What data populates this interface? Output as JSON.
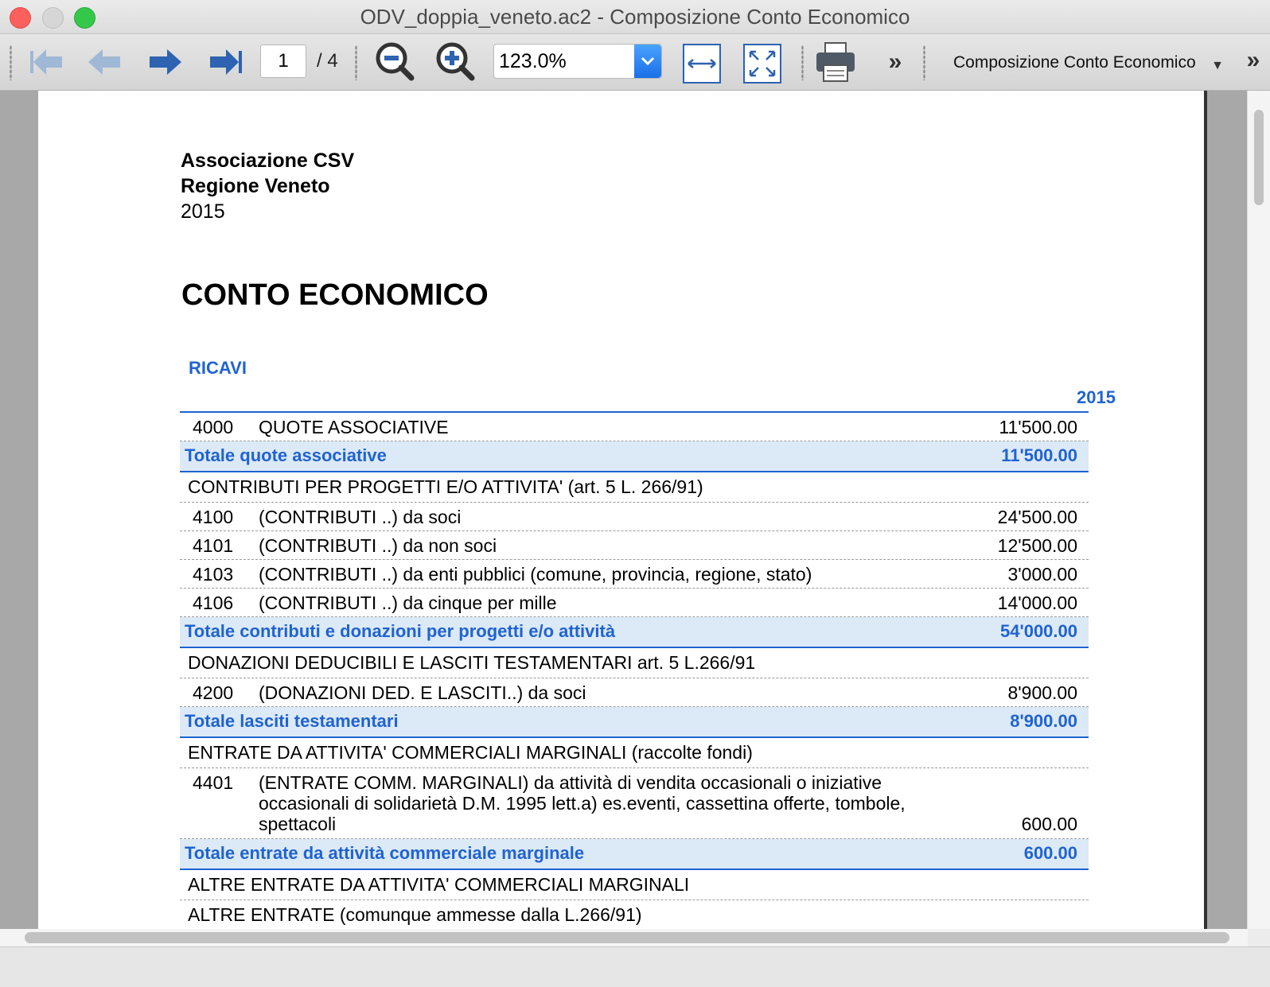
{
  "window": {
    "title": "ODV_doppia_veneto.ac2 - Composizione Conto Economico"
  },
  "toolbar": {
    "page_current": "1",
    "page_total": "/ 4",
    "zoom": "123.0%",
    "sheet_title": "Composizione Conto Economico",
    "icons": [
      "first-page-icon",
      "previous-page-icon",
      "next-page-icon",
      "last-page-icon",
      "zoom-out-icon",
      "zoom-in-icon",
      "fit-width-icon",
      "fit-page-icon",
      "print-icon",
      "more-icon"
    ]
  },
  "document": {
    "org_name": "Associazione CSV",
    "region": "Regione Veneto",
    "year": "2015",
    "heading": "CONTO ECONOMICO",
    "section": "RICAVI",
    "column_year": "2015",
    "rows": [
      {
        "type": "item",
        "code": "4000",
        "desc": "QUOTE ASSOCIATIVE",
        "amount": "11'500.00"
      },
      {
        "type": "total",
        "desc": "Totale quote associative",
        "amount": "11'500.00"
      },
      {
        "type": "group",
        "desc": "CONTRIBUTI PER PROGETTI E/O ATTIVITA'  (art. 5 L. 266/91)"
      },
      {
        "type": "item",
        "code": "4100",
        "desc": "(CONTRIBUTI ..) da soci",
        "amount": "24'500.00"
      },
      {
        "type": "item",
        "code": "4101",
        "desc": "(CONTRIBUTI ..) da non soci",
        "amount": "12'500.00"
      },
      {
        "type": "item",
        "code": "4103",
        "desc": "(CONTRIBUTI ..)  da enti pubblici (comune, provincia, regione, stato)",
        "amount": "3'000.00"
      },
      {
        "type": "item",
        "code": "4106",
        "desc": "(CONTRIBUTI ..) da cinque per mille",
        "amount": "14'000.00"
      },
      {
        "type": "total",
        "desc": "Totale contributi e donazioni per progetti e/o attività",
        "amount": "54'000.00"
      },
      {
        "type": "group",
        "desc": "DONAZIONI DEDUCIBILI E LASCITI TESTAMENTARI art. 5 L.266/91"
      },
      {
        "type": "item",
        "code": "4200",
        "desc": "(DONAZIONI DED. E LASCITI..) da soci",
        "amount": "8'900.00"
      },
      {
        "type": "total",
        "desc": "Totale lasciti testamentari",
        "amount": "8'900.00"
      },
      {
        "type": "group",
        "desc": "ENTRATE DA ATTIVITA' COMMERCIALI MARGINALI (raccolte fondi)"
      },
      {
        "type": "item",
        "code": "4401",
        "desc": "(ENTRATE COMM. MARGINALI) da attività di vendita occasionali o iniziative occasionali di solidarietà D.M. 1995 lett.a) es.eventi, cassettina offerte, tombole, spettacoli",
        "amount": "600.00",
        "tall": true
      },
      {
        "type": "total",
        "desc": "Totale entrate da attività commerciale marginale",
        "amount": "600.00"
      },
      {
        "type": "group",
        "desc": "ALTRE ENTRATE DA ATTIVITA' COMMERCIALI MARGINALI"
      },
      {
        "type": "group",
        "desc": "ALTRE ENTRATE (comunque ammesse dalla L.266/91)"
      }
    ]
  },
  "colors": {
    "accent": "#1f63d1",
    "total_bg": "#dce9f6"
  }
}
